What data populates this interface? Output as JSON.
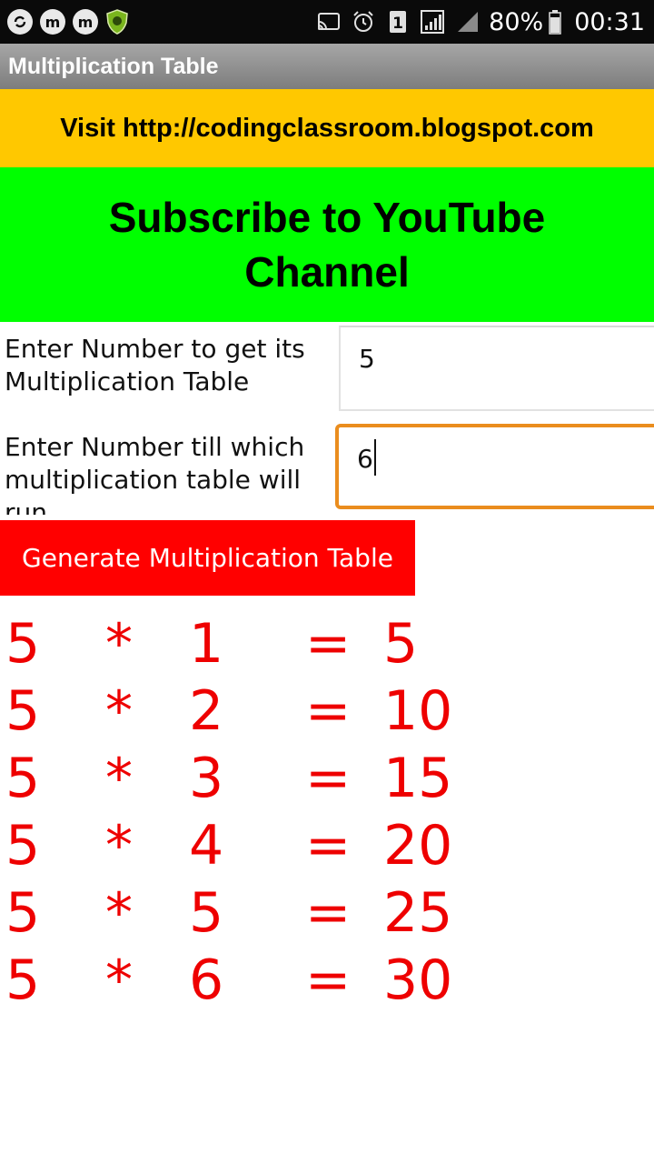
{
  "status_bar": {
    "battery": "80%",
    "time": "00:31",
    "sim_slot": "1"
  },
  "app": {
    "title": "Multiplication Table"
  },
  "blog_banner": {
    "text": "Visit http://codingclassroom.blogspot.com"
  },
  "youtube_banner": {
    "text": "Subscribe to YouTube Channel"
  },
  "form": {
    "number_label": "Enter Number to get its Multiplication Table",
    "number_value": "5",
    "limit_label": "Enter Number till which multiplication table will run",
    "limit_value": "6"
  },
  "generate_button": {
    "label": "Generate Multiplication Table"
  },
  "results": [
    {
      "a": "5",
      "op": "*",
      "b": "1",
      "eq": "=",
      "result": "5"
    },
    {
      "a": "5",
      "op": "*",
      "b": "2",
      "eq": "=",
      "result": "10"
    },
    {
      "a": "5",
      "op": "*",
      "b": "3",
      "eq": "=",
      "result": "15"
    },
    {
      "a": "5",
      "op": "*",
      "b": "4",
      "eq": "=",
      "result": "20"
    },
    {
      "a": "5",
      "op": "*",
      "b": "5",
      "eq": "=",
      "result": "25"
    },
    {
      "a": "5",
      "op": "*",
      "b": "6",
      "eq": "=",
      "result": "30"
    }
  ],
  "colors": {
    "blog_banner_bg": "#ffc800",
    "youtube_banner_bg": "#00ff00",
    "button_bg": "#ff0000",
    "result_text": "#ee0000",
    "focused_input_border": "#ea8d1e"
  }
}
